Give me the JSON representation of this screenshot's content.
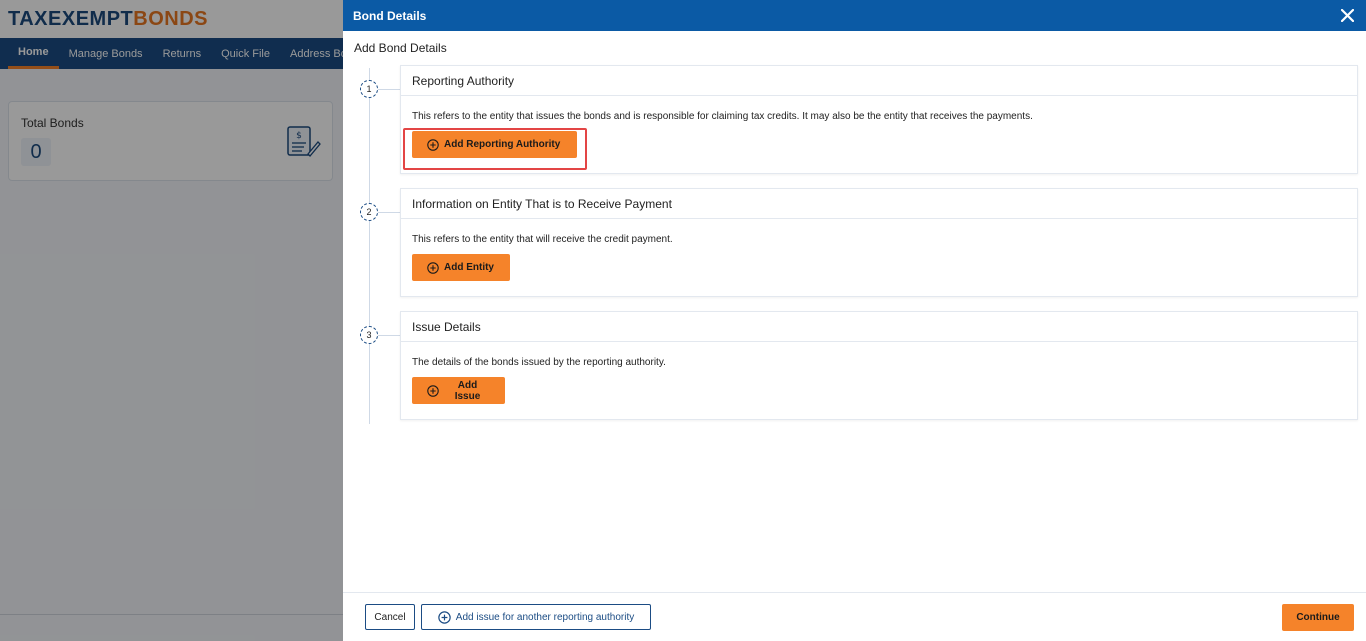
{
  "app": {
    "logo_main": "TAXEXEMPT",
    "logo_accent": "BONDS",
    "nav": [
      "Home",
      "Manage Bonds",
      "Returns",
      "Quick File",
      "Address Book"
    ],
    "stat_label": "Total Bonds",
    "stat_value": "0"
  },
  "drawer": {
    "title": "Bond Details",
    "subtitle": "Add Bond Details",
    "steps": [
      {
        "number": "1",
        "title": "Reporting Authority",
        "description": "This refers to the entity that issues the bonds and is responsible for claiming tax credits. It may also be the entity that receives the payments.",
        "button": "Add Reporting Authority"
      },
      {
        "number": "2",
        "title": "Information on Entity That is to Receive Payment",
        "description": "This refers to the entity that will receive the credit payment.",
        "button": "Add Entity"
      },
      {
        "number": "3",
        "title": "Issue Details",
        "description": "The details of the bonds issued by the reporting authority.",
        "button": "Add Issue"
      }
    ],
    "footer": {
      "cancel": "Cancel",
      "add_another": "Add issue for another reporting authority",
      "continue": "Continue"
    }
  },
  "colors": {
    "header_blue": "#0b5aa5",
    "nav_blue": "#1b4c84",
    "accent_orange": "#f5832a",
    "highlight_red": "#e34545"
  },
  "icons": {
    "close": "close-icon",
    "plus": "plus-circle-icon",
    "bond_document": "bond-document-icon"
  }
}
